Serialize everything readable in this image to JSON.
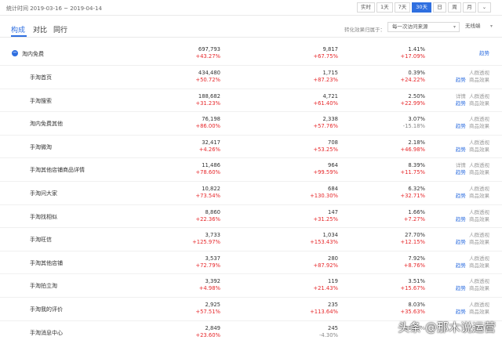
{
  "header": {
    "date_range": "统计时间 2019-03-16 ~ 2019-04-14",
    "periods": [
      "实时",
      "1天",
      "7天",
      "30天",
      "日",
      "周",
      "月"
    ],
    "active_period": "30天",
    "more_icon": "chevron-down-icon"
  },
  "tabs": [
    {
      "label": "构成",
      "active": true
    },
    {
      "label": "对比",
      "active": false
    },
    {
      "label": "同行",
      "active": false
    }
  ],
  "filters": {
    "attribution_label": "转化效果归属于：",
    "attribution_value": "每一次访问来源",
    "terminal_value": "无线端"
  },
  "colors": {
    "accent": "#2f6fe0",
    "increase": "#e6282b",
    "decrease": "#888888"
  },
  "rows": [
    {
      "name": "淘内免费",
      "v1": "697,793",
      "c1": "+43.27%",
      "v2": "9,817",
      "c2": "+67.75%",
      "v3": "1.41%",
      "c3": "+17.09%",
      "actions": [
        "趋势"
      ],
      "parent": true
    },
    {
      "name": "手淘首页",
      "v1": "434,480",
      "c1": "+50.72%",
      "v2": "1,715",
      "c2": "+87.23%",
      "v3": "0.39%",
      "c3": "+24.22%",
      "actions": [
        "人群透视",
        "趋势",
        "商品效果"
      ]
    },
    {
      "name": "手淘搜索",
      "v1": "188,682",
      "c1": "+31.23%",
      "v2": "4,721",
      "c2": "+61.40%",
      "v3": "2.50%",
      "c3": "+22.99%",
      "actions": [
        "详情",
        "人群透视",
        "趋势",
        "商品效果"
      ]
    },
    {
      "name": "淘内免费其他",
      "v1": "76,198",
      "c1": "+86.00%",
      "v2": "2,338",
      "c2": "+57.76%",
      "v3": "3.07%",
      "c3": "-15.18%",
      "actions": [
        "人群透视",
        "趋势",
        "商品效果"
      ]
    },
    {
      "name": "手淘微淘",
      "v1": "32,417",
      "c1": "+4.26%",
      "v2": "708",
      "c2": "+53.25%",
      "v3": "2.18%",
      "c3": "+46.98%",
      "actions": [
        "人群透视",
        "趋势",
        "商品效果"
      ]
    },
    {
      "name": "手淘其他店铺商品详情",
      "v1": "11,486",
      "c1": "+78.60%",
      "v2": "964",
      "c2": "+99.59%",
      "v3": "8.39%",
      "c3": "+11.75%",
      "actions": [
        "详情",
        "人群透视",
        "趋势",
        "商品效果"
      ]
    },
    {
      "name": "手淘问大家",
      "v1": "10,822",
      "c1": "+73.54%",
      "v2": "684",
      "c2": "+130.30%",
      "v3": "6.32%",
      "c3": "+32.71%",
      "actions": [
        "人群透视",
        "趋势",
        "商品效果"
      ]
    },
    {
      "name": "手淘找相似",
      "v1": "8,860",
      "c1": "+22.36%",
      "v2": "147",
      "c2": "+31.25%",
      "v3": "1.66%",
      "c3": "+7.27%",
      "actions": [
        "人群透视",
        "趋势",
        "商品效果"
      ]
    },
    {
      "name": "手淘旺信",
      "v1": "3,733",
      "c1": "+125.97%",
      "v2": "1,034",
      "c2": "+153.43%",
      "v3": "27.70%",
      "c3": "+12.15%",
      "actions": [
        "人群透视",
        "趋势",
        "商品效果"
      ]
    },
    {
      "name": "手淘其他店铺",
      "v1": "3,537",
      "c1": "+72.79%",
      "v2": "280",
      "c2": "+87.92%",
      "v3": "7.92%",
      "c3": "+8.76%",
      "actions": [
        "人群透视",
        "趋势",
        "商品效果"
      ]
    },
    {
      "name": "手淘拍立淘",
      "v1": "3,392",
      "c1": "+4.98%",
      "v2": "119",
      "c2": "+21.43%",
      "v3": "3.51%",
      "c3": "+15.67%",
      "actions": [
        "人群透视",
        "趋势",
        "商品效果"
      ]
    },
    {
      "name": "手淘我的评价",
      "v1": "2,925",
      "c1": "+57.51%",
      "v2": "235",
      "c2": "+113.64%",
      "v3": "8.03%",
      "c3": "+35.63%",
      "actions": [
        "人群透视",
        "趋势",
        "商品效果"
      ]
    },
    {
      "name": "手淘消息中心",
      "v1": "2,849",
      "c1": "+23.60%",
      "v2": "245",
      "c2": "-4.30%",
      "v3": "",
      "c3": "-22.57%",
      "actions": [
        "人群透视"
      ]
    }
  ],
  "watermark": "头条 @那木说运营"
}
